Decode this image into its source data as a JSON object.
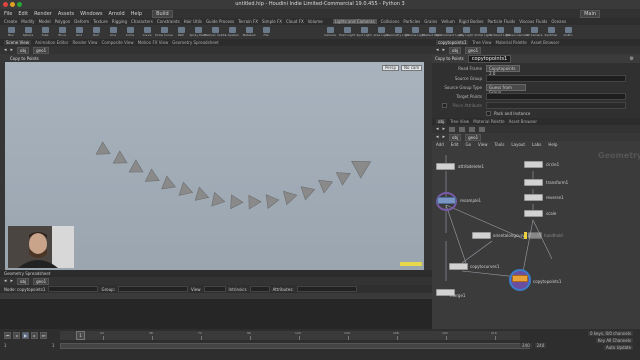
{
  "window": {
    "title": "untitled.hip - Houdini Indie Limited-Commercial 19.0.455 - Python 3"
  },
  "menubar": {
    "items": [
      "File",
      "Edit",
      "Render",
      "Assets",
      "Windows",
      "Arnold",
      "Help"
    ],
    "desktop": "Build",
    "right_label": "Main"
  },
  "shelf_tabs": [
    "Create",
    "Modify",
    "Model",
    "Polygon",
    "Deform",
    "Texture",
    "Rigging",
    "Characters",
    "Constraints",
    "Hair Utils",
    "Guide Process",
    "Terrain FX",
    "Simple FX",
    "Cloud FX",
    "Volume"
  ],
  "shelf_tabs_right": [
    "Lights and Cameras",
    "Collisions",
    "Particles",
    "Grains",
    "Vellum",
    "Rigid Bodies",
    "Particle Fluids",
    "Viscous Fluids",
    "Oceans"
  ],
  "shelf_tools": [
    "Box",
    "Sphere",
    "Tube",
    "Torus",
    "Grid",
    "Null",
    "Line",
    "Circle",
    "Curve",
    "Draw Curve",
    "Path",
    "Spray Paint",
    "Platonic Solids",
    "L-System",
    "Metaball",
    "File"
  ],
  "shelf_tools_right": [
    "Camera",
    "Point Light",
    "Spot Light",
    "Area Light",
    "Geometry Light",
    "Volume Light",
    "Distant Light",
    "Environment Light",
    "Sky Light",
    "Portal Light",
    "Ambient Light",
    "Stereo Camera",
    "VR Camera",
    "Switcher",
    "GoPro"
  ],
  "left_tabs": [
    "Scene View",
    "Animation Editor",
    "Render View",
    "Composite View",
    "Motion FX View",
    "Geometry Spreadsheet"
  ],
  "left_path": {
    "context": "obj",
    "node": "geo1"
  },
  "viewport": {
    "title": "Copy to Points",
    "view": "Persp",
    "camera": "No cam"
  },
  "sheet": {
    "tabs": [
      "Geometry Spreadsheet"
    ],
    "path": {
      "context": "obj",
      "node": "geo1"
    },
    "node_label": "Node: copytopoints1",
    "group_label": "Group:",
    "view_label": "View",
    "intrinsics_label": "Intrinsics",
    "attributes_label": "Attributes:"
  },
  "timeline": {
    "current_frame": "1",
    "start": "1",
    "end": "240",
    "end2": "240",
    "ticks": [
      "24",
      "48",
      "72",
      "96",
      "120",
      "144",
      "168",
      "192",
      "216"
    ],
    "keys_label": "0 keys, 0/0 channels",
    "key_all": "Key All Channels",
    "auto_update": "Auto Update"
  },
  "params": {
    "tabs": [
      "copytopoints1",
      "Tree View",
      "Material Palette",
      "Asset Browser"
    ],
    "path": {
      "context": "obj",
      "node": "geo1"
    },
    "node_type": "Copy to Points",
    "node_name": "copytopoints1",
    "rows": [
      {
        "label": "Read Frame",
        "value": "Copytopoints 2.0"
      },
      {
        "label": "Source Group",
        "value": ""
      },
      {
        "label": "Source Group Type",
        "value": "Guess from Group"
      },
      {
        "label": "Target Points",
        "value": ""
      },
      {
        "label": "Piece Attribute",
        "value": ""
      },
      {
        "label": "",
        "value": "Pack and Instance"
      }
    ]
  },
  "network": {
    "tabs": [
      "obj",
      "Tree View",
      "Material Palette",
      "Asset Browser"
    ],
    "path": {
      "context": "obj",
      "node": "geo1"
    },
    "menu": [
      "Add",
      "Edit",
      "Go",
      "View",
      "Tools",
      "Layout",
      "Labs",
      "Help"
    ],
    "watermark": "Geometry",
    "nodes": [
      {
        "id": "attribdelete1",
        "label": "attribdelete1",
        "sub": ""
      },
      {
        "id": "circle1",
        "label": "circle1",
        "sub": ""
      },
      {
        "id": "transform1",
        "label": "transform1",
        "sub": ""
      },
      {
        "id": "reverse1",
        "label": "reverse1",
        "sub": ""
      },
      {
        "id": "scale",
        "label": "scale",
        "sub": ""
      },
      {
        "id": "resample1",
        "label": "resample1",
        "sub": ""
      },
      {
        "id": "orientalongcurve1",
        "label": "orientalongcurve1",
        "sub": ""
      },
      {
        "id": "handheld",
        "label": "handheld",
        "sub": ""
      },
      {
        "id": "copytocurves1",
        "label": "copytocurves1",
        "sub": ""
      },
      {
        "id": "copytopoints1",
        "label": "copytopoints1",
        "sub": ""
      },
      {
        "id": "merge1",
        "label": "merge1",
        "sub": ""
      }
    ]
  },
  "colors": {
    "viewport_top": "#a8b3be",
    "selected_node": "#5577aa",
    "orient_flag": "#e8d040"
  }
}
